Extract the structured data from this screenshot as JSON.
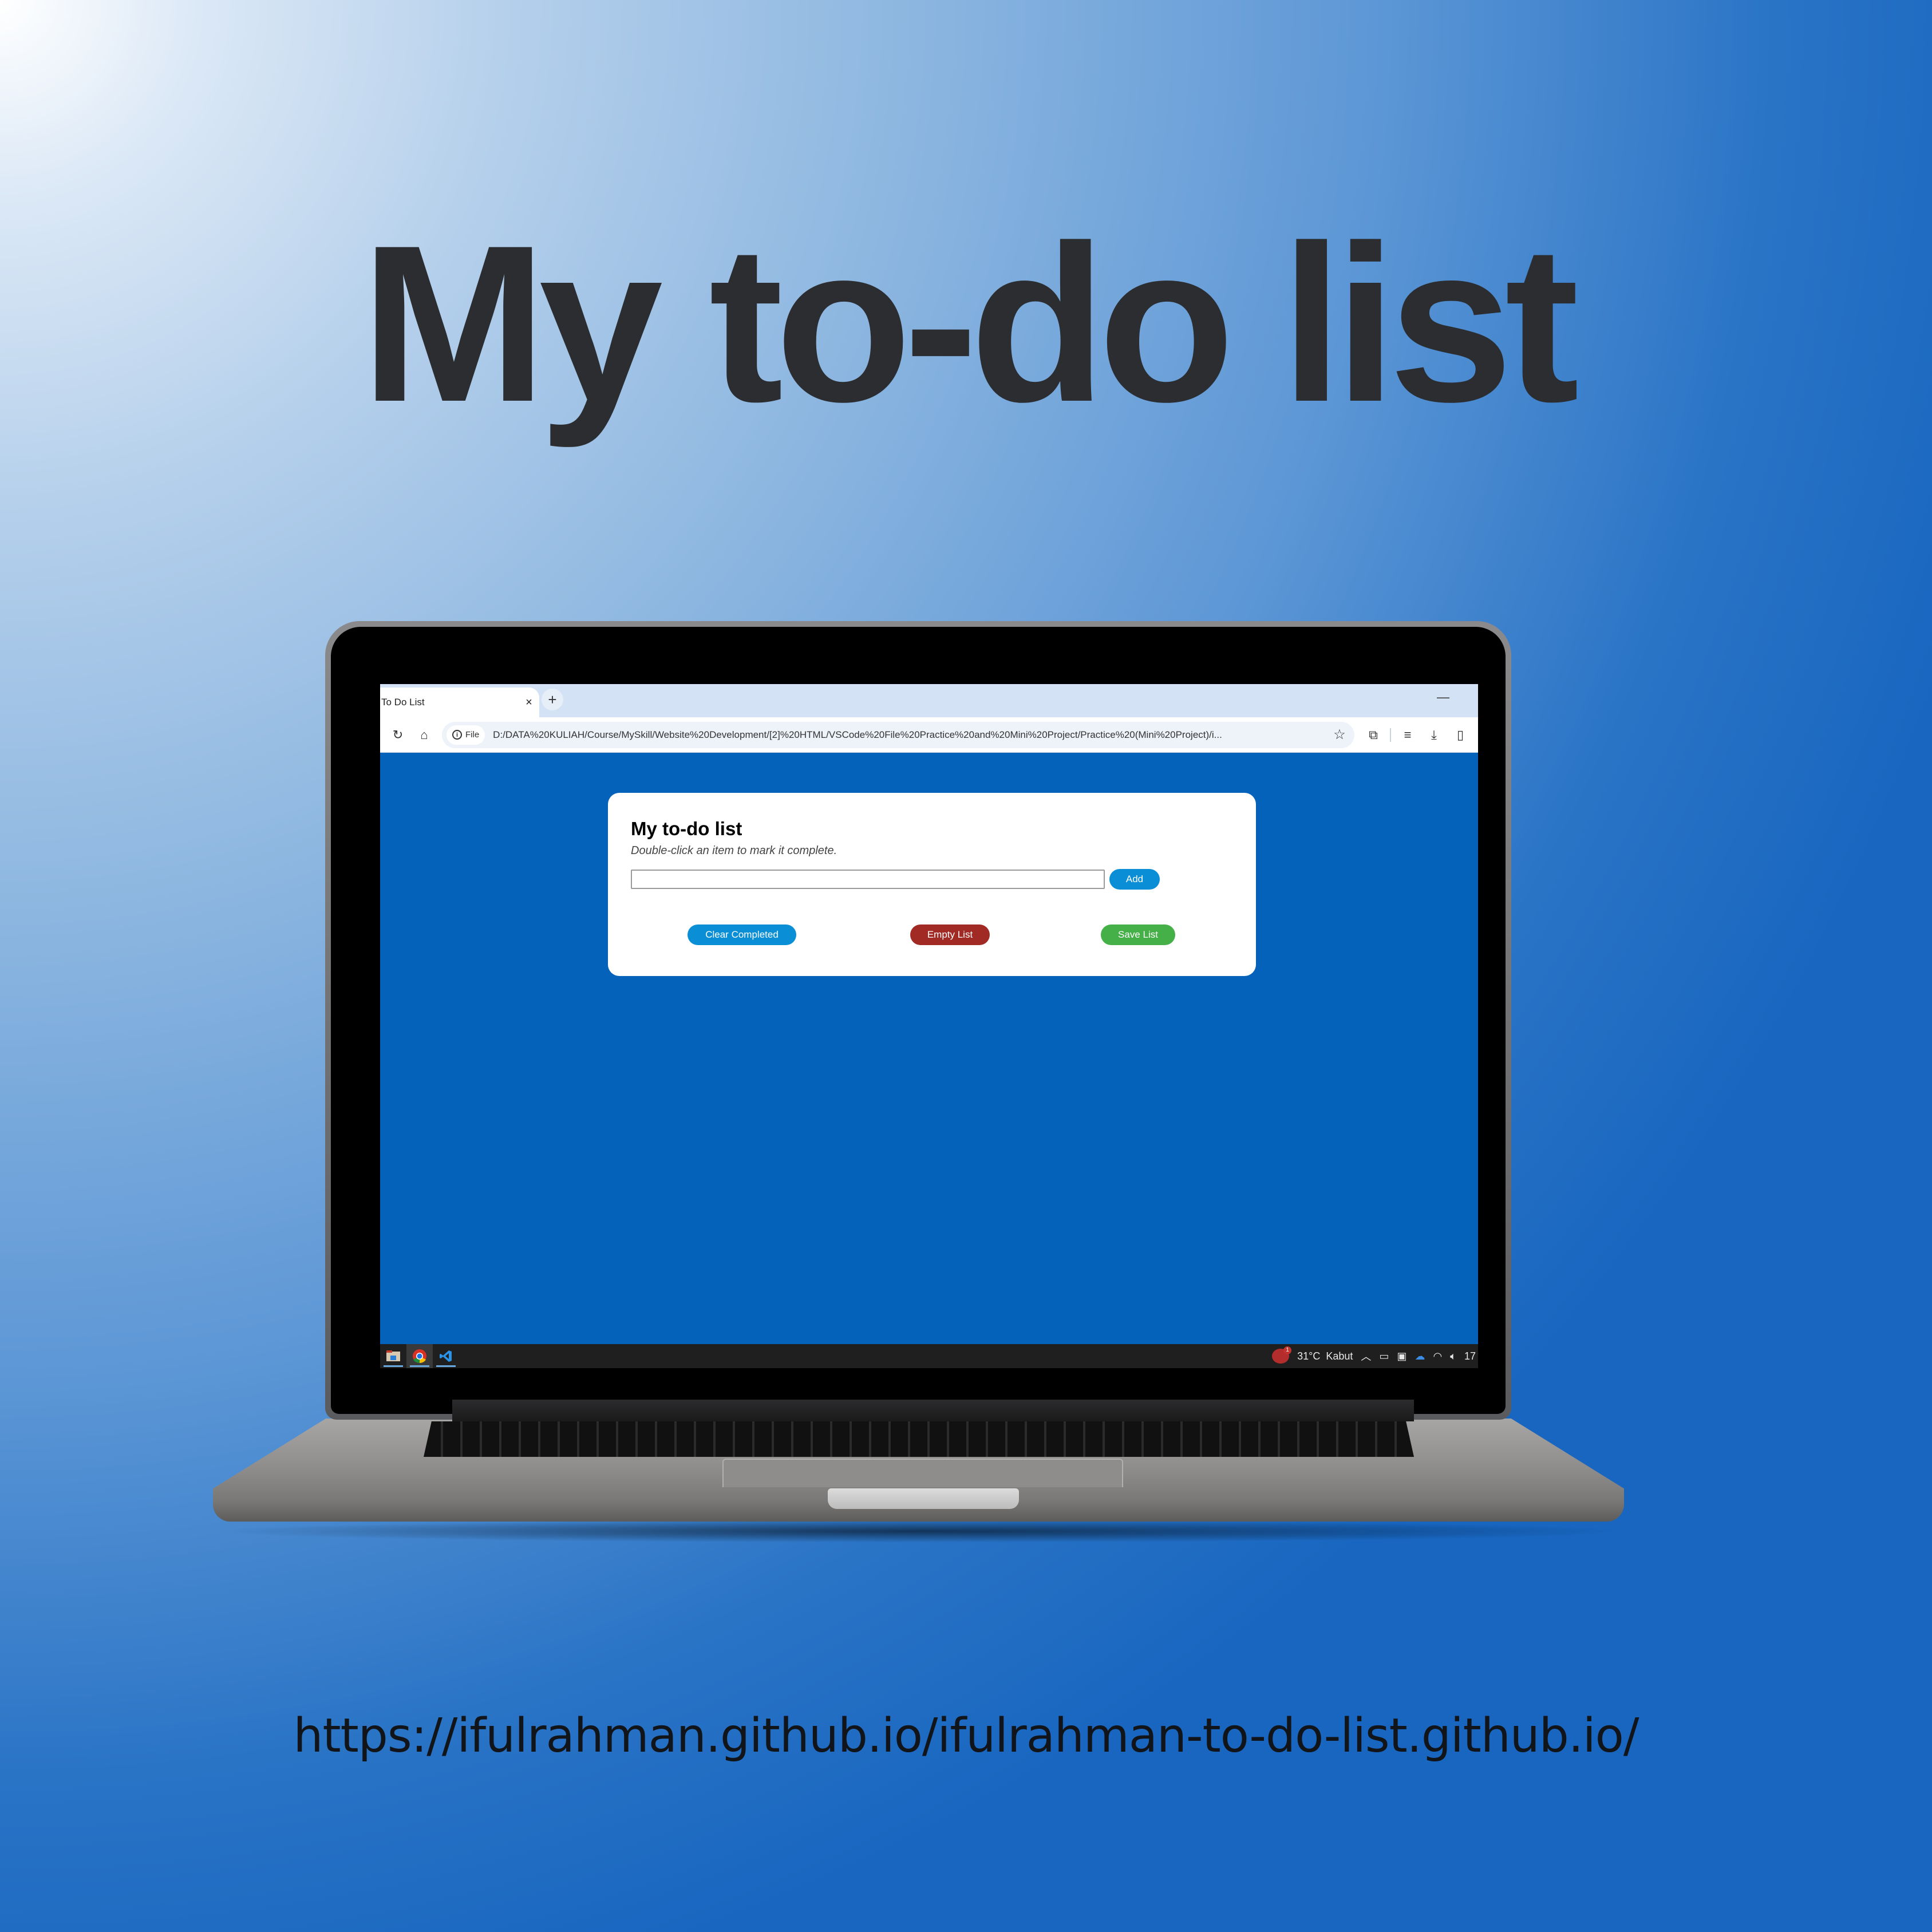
{
  "poster": {
    "headline": "My to-do list",
    "url_caption": "https://ifulrahman.github.io/ifulrahman-to-do-list.github.io/"
  },
  "browser": {
    "tab_title": "To Do List",
    "tab_close_icon": "×",
    "new_tab_icon": "+",
    "minimize_icon": "—",
    "site_chip_label": "File",
    "address": "D:/DATA%20KULIAH/Course/MySkill/Website%20Development/[2]%20HTML/VSCode%20File%20Practice%20and%20Mini%20Project/Practice%20(Mini%20Project)/i...",
    "icons": {
      "reload": "↻",
      "home": "⌂",
      "star": "☆",
      "extensions": "⧉",
      "media": "≡",
      "download": "⤓",
      "side_panel": "▯"
    }
  },
  "app": {
    "title": "My to-do list",
    "hint": "Double-click an item to mark it complete.",
    "input_value": "",
    "input_placeholder": "",
    "add_label": "Add",
    "clear_completed_label": "Clear Completed",
    "empty_list_label": "Empty List",
    "save_list_label": "Save List",
    "colors": {
      "page_bg": "#0562bb",
      "add": "#0a8fd6",
      "clear": "#0a8fd6",
      "empty": "#a12a24",
      "save": "#45b047"
    }
  },
  "taskbar": {
    "apps": [
      "file-explorer",
      "chrome",
      "vscode"
    ],
    "weather_badge_count": "1",
    "weather": "31°C  Kabut",
    "tray_icons": [
      "chevron-up",
      "battery",
      "camera",
      "onedrive",
      "wifi",
      "volume"
    ],
    "clock_partial": "17"
  }
}
